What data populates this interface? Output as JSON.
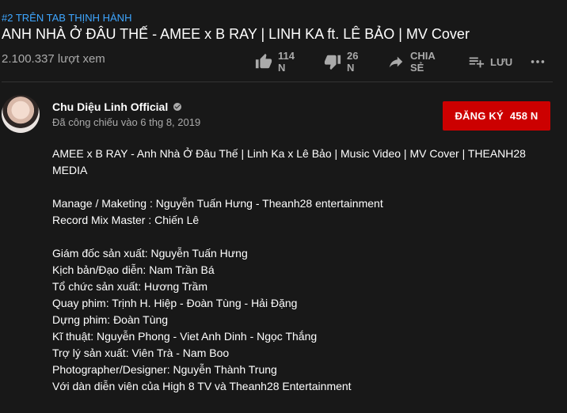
{
  "trending_label": "#2 TRÊN TAB THỊNH HÀNH",
  "video_title": "ANH NHÀ Ở ĐÂU THẾ - AMEE x B RAY | LINH KA ft. LÊ BẢO | MV Cover",
  "view_count": "2.100.337 lượt xem",
  "actions": {
    "like_count": "114 N",
    "dislike_count": "26 N",
    "share_label": "CHIA SẺ",
    "save_label": "LƯU"
  },
  "icons": {
    "like": "thumb-up-icon",
    "dislike": "thumb-down-icon",
    "share": "share-arrow-icon",
    "save": "add-to-playlist-icon",
    "more": "more-dots-icon",
    "verified": "verified-check-icon"
  },
  "channel": {
    "name": "Chu Diệu Linh Official",
    "premiered": "Đã công chiếu vào 6 thg 8, 2019"
  },
  "subscribe": {
    "label": "ĐĂNG KÝ",
    "count": "458 N"
  },
  "description": {
    "line1": "AMEE x B RAY - Anh Nhà Ở Đâu Thế | Linh Ka x Lê Bảo | Music Video | MV Cover | THEANH28 MEDIA",
    "line2": "Manage / Maketing : Nguyễn Tuấn Hưng - Theanh28 entertainment",
    "line3": "Record Mix Master : Chiến Lê",
    "line4": "Giám đốc sản xuất: Nguyễn Tuấn Hưng",
    "line5": "Kịch bản/Đạo diễn: Nam Trần Bá",
    "line6": "Tổ chức sản xuất: Hương Trầm",
    "line7": "Quay phim: Trịnh H. Hiệp - Đoàn Tùng - Hải Đặng",
    "line8": "Dựng phim: Đoàn Tùng",
    "line9": "Kĩ thuật: Nguyễn Phong - Viet Anh Dinh - Ngọc Thắng",
    "line10": "Trợ lý sản xuất: Viên Trà - Nam Boo",
    "line11": "Photographer/Designer: Nguyễn Thành Trung",
    "line12": "Với dàn diễn viên của High 8 TV và Theanh28 Entertainment"
  },
  "colors": {
    "background": "#181818",
    "subscribe": "#cc0000",
    "link": "#3ea6ff",
    "secondary_text": "#aaaaaa"
  }
}
